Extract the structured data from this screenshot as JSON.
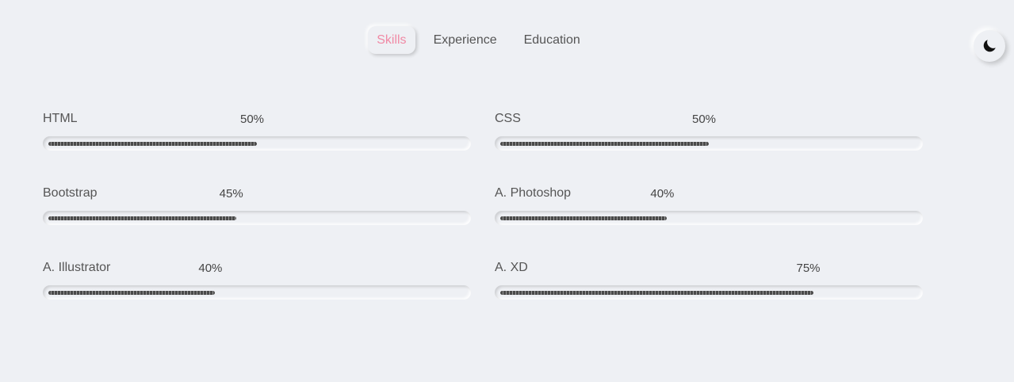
{
  "nav": {
    "tabs": [
      {
        "label": "Skills",
        "active": true
      },
      {
        "label": "Experience",
        "active": false
      },
      {
        "label": "Education",
        "active": false
      }
    ],
    "active_color": "#f08aa5"
  },
  "theme_toggle": {
    "icon": "moon-icon"
  },
  "skills": [
    {
      "name": "HTML",
      "percent_label": "50%",
      "percent": 50
    },
    {
      "name": "CSS",
      "percent_label": "50%",
      "percent": 50
    },
    {
      "name": "Bootstrap",
      "percent_label": "45%",
      "percent": 45
    },
    {
      "name": "A. Photoshop",
      "percent_label": "40%",
      "percent": 40
    },
    {
      "name": "A. Illustrator",
      "percent_label": "40%",
      "percent": 40
    },
    {
      "name": "A. XD",
      "percent_label": "75%",
      "percent": 75
    }
  ]
}
